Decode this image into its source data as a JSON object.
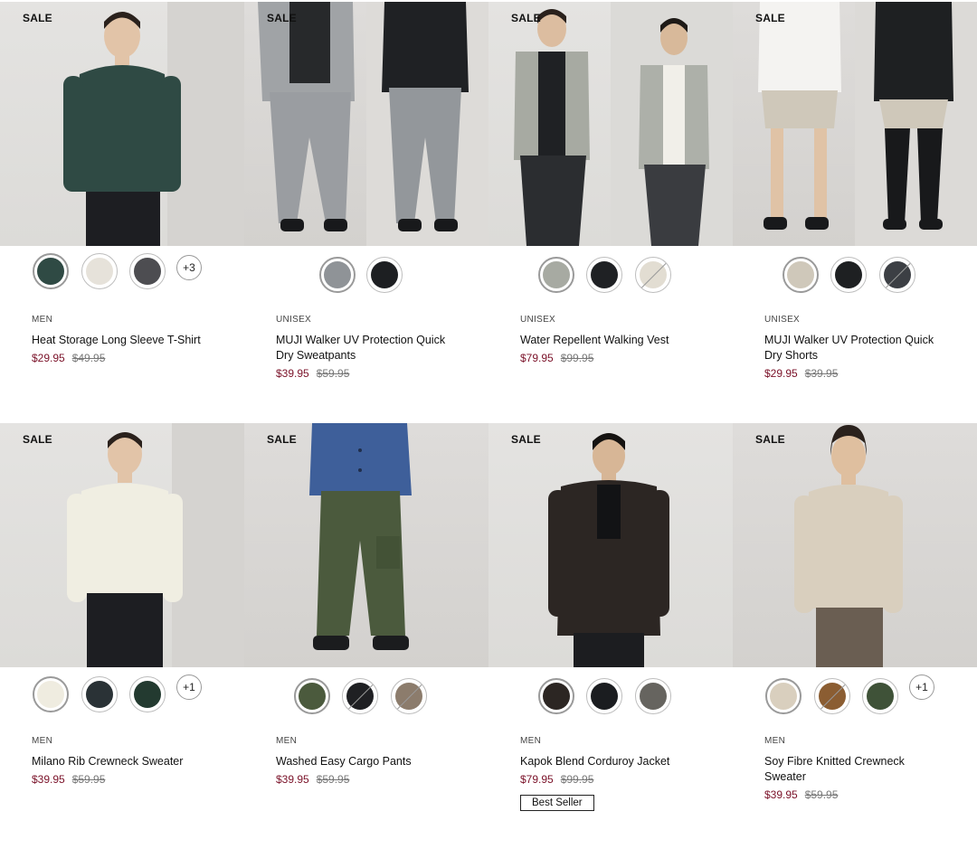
{
  "products": [
    {
      "sale": "SALE",
      "category": "MEN",
      "name": "Heat Storage Long Sleeve T-Shirt",
      "price": "$29.95",
      "was": "$49.95",
      "more": "+3",
      "swatches": [
        "#2f4a44",
        "#e6e2da",
        "#4d4d51"
      ]
    },
    {
      "sale": "SALE",
      "category": "UNISEX",
      "name": "MUJI Walker UV Protection Quick Dry Sweatpants",
      "price": "$39.95",
      "was": "$59.95",
      "more": "",
      "swatches": [
        "#8f9397",
        "#1d1f22"
      ]
    },
    {
      "sale": "SALE",
      "category": "UNISEX",
      "name": "Water Repellent Walking Vest",
      "price": "$79.95",
      "was": "$99.95",
      "more": "",
      "swatches": [
        "#a7aaa2",
        "#1f2124",
        "#e2ddd2"
      ]
    },
    {
      "sale": "SALE",
      "category": "UNISEX",
      "name": "MUJI Walker UV Protection Quick Dry Shorts",
      "price": "$29.95",
      "was": "$39.95",
      "more": "",
      "swatches": [
        "#cfc8ba",
        "#1e2022",
        "#3c3f44"
      ]
    },
    {
      "sale": "SALE",
      "category": "MEN",
      "name": "Milano Rib Crewneck Sweater",
      "price": "$39.95",
      "was": "$59.95",
      "more": "+1",
      "swatches": [
        "#efece0",
        "#2a3236",
        "#233a30"
      ]
    },
    {
      "sale": "SALE",
      "category": "MEN",
      "name": "Washed Easy Cargo Pants",
      "price": "$39.95",
      "was": "$59.95",
      "more": "",
      "swatches": [
        "#4b5a3d",
        "#1f2023",
        "#8c7c6c"
      ]
    },
    {
      "sale": "SALE",
      "category": "MEN",
      "name": "Kapok Blend Corduroy Jacket",
      "price": "$79.95",
      "was": "$99.95",
      "more": "",
      "badge": "Best Seller",
      "swatches": [
        "#2c2623",
        "#1b1d20",
        "#66645f"
      ]
    },
    {
      "sale": "SALE",
      "category": "MEN",
      "name": "Soy Fibre Knitted Crewneck Sweater",
      "price": "$39.95",
      "was": "$59.95",
      "more": "+1",
      "swatches": [
        "#d9cfbe",
        "#8b5d32",
        "#3f5238"
      ]
    }
  ]
}
